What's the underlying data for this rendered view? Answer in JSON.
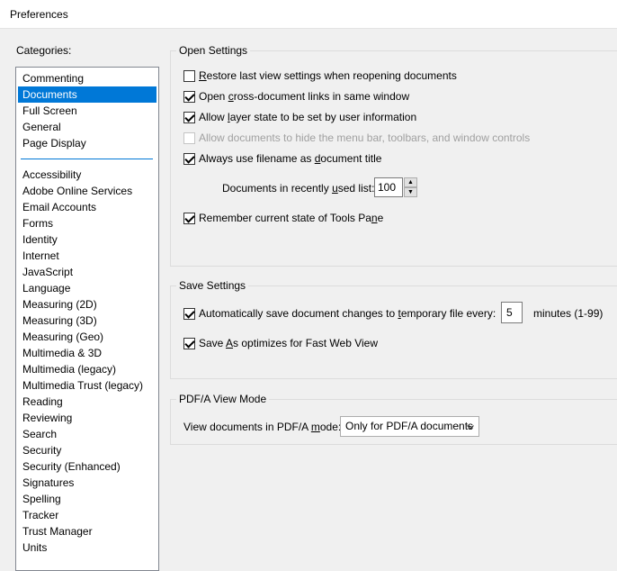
{
  "window": {
    "title": "Preferences"
  },
  "categories_label": "Categories:",
  "categories_top": [
    {
      "label": "Commenting",
      "selected": false
    },
    {
      "label": "Documents",
      "selected": true
    },
    {
      "label": "Full Screen",
      "selected": false
    },
    {
      "label": "General",
      "selected": false
    },
    {
      "label": "Page Display",
      "selected": false
    }
  ],
  "categories_bottom": [
    "Accessibility",
    "Adobe Online Services",
    "Email Accounts",
    "Forms",
    "Identity",
    "Internet",
    "JavaScript",
    "Language",
    "Measuring (2D)",
    "Measuring (3D)",
    "Measuring (Geo)",
    "Multimedia & 3D",
    "Multimedia (legacy)",
    "Multimedia Trust (legacy)",
    "Reading",
    "Reviewing",
    "Search",
    "Security",
    "Security (Enhanced)",
    "Signatures",
    "Spelling",
    "Tracker",
    "Trust Manager",
    "Units"
  ],
  "open_settings": {
    "legend": "Open Settings",
    "restore": {
      "pre": "",
      "u": "R",
      "post": "estore last view settings when reopening documents",
      "checked": false
    },
    "cross_links": {
      "pre": "Open ",
      "u": "c",
      "post": "ross-document links in same window",
      "checked": true
    },
    "layer_state": {
      "pre": "Allow ",
      "u": "l",
      "post": "ayer state to be set by user information",
      "checked": true
    },
    "hide_menu": {
      "text": "Allow documents to hide the menu bar, toolbars, and window controls",
      "checked": false,
      "disabled": true
    },
    "filename_title": {
      "pre": "Always use filename as ",
      "u": "d",
      "post": "ocument title",
      "checked": true
    },
    "recent": {
      "pre": "Documents in recently ",
      "u": "u",
      "post": "sed list:",
      "value": "100"
    },
    "tools_pane": {
      "pre": "Remember current state of Tools Pa",
      "u": "n",
      "post": "e",
      "checked": true
    }
  },
  "save_settings": {
    "legend": "Save Settings",
    "autosave": {
      "pre": "Automatically save document changes to ",
      "u": "t",
      "post": "emporary file every:",
      "checked": true,
      "value": "5",
      "unit": "minutes (1-99)"
    },
    "fast_web": {
      "pre": "Save ",
      "u": "A",
      "post": "s optimizes for Fast Web View",
      "checked": true
    }
  },
  "pdfa": {
    "legend": "PDF/A View Mode",
    "label": {
      "pre": "View documents in PDF/A ",
      "u": "m",
      "post": "ode:"
    },
    "selected": "Only for PDF/A documents"
  }
}
